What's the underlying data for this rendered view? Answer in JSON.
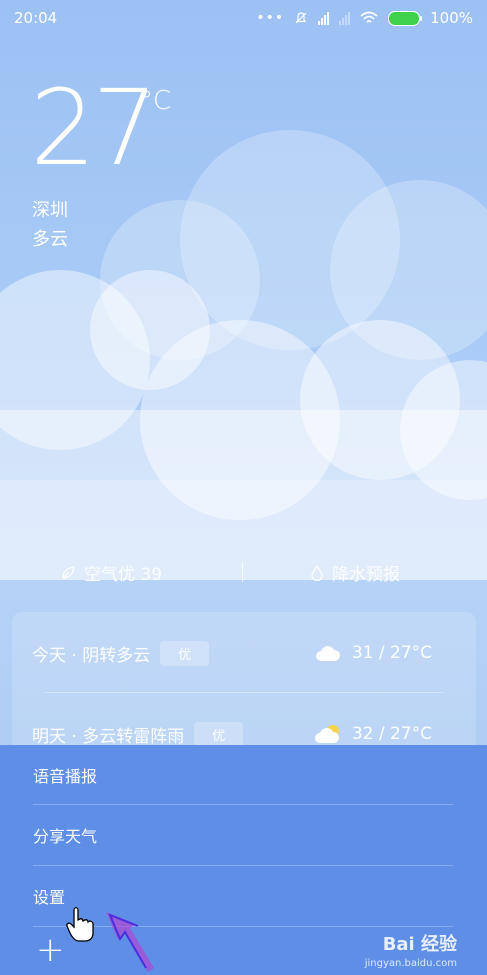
{
  "status_bar": {
    "time": "20:04",
    "battery": "100%"
  },
  "weather": {
    "temperature": "27",
    "unit": "°C",
    "city": "深圳",
    "condition": "多云"
  },
  "info_row": {
    "aqi_label": "空气优 39",
    "precip_label": "降水预报"
  },
  "forecast": [
    {
      "day": "今天 · 阴转多云",
      "aqi_badge": "优",
      "icon": "cloud-icon",
      "temps": "31 / 27°C"
    },
    {
      "day": "明天 · 多云转雷阵雨",
      "aqi_badge": "优",
      "icon": "partly-sunny-icon",
      "temps": "32 / 27°C"
    }
  ],
  "menu": {
    "items": [
      "语音播报",
      "分享天气",
      "设置"
    ],
    "add_symbol": "+"
  },
  "watermark": {
    "main": "Bai 经验",
    "sub": "jingyan.baidu.com"
  },
  "colors": {
    "menu_bg": "#5e8ee6",
    "battery": "#3fd14a",
    "sky": "#a9cbf6"
  }
}
